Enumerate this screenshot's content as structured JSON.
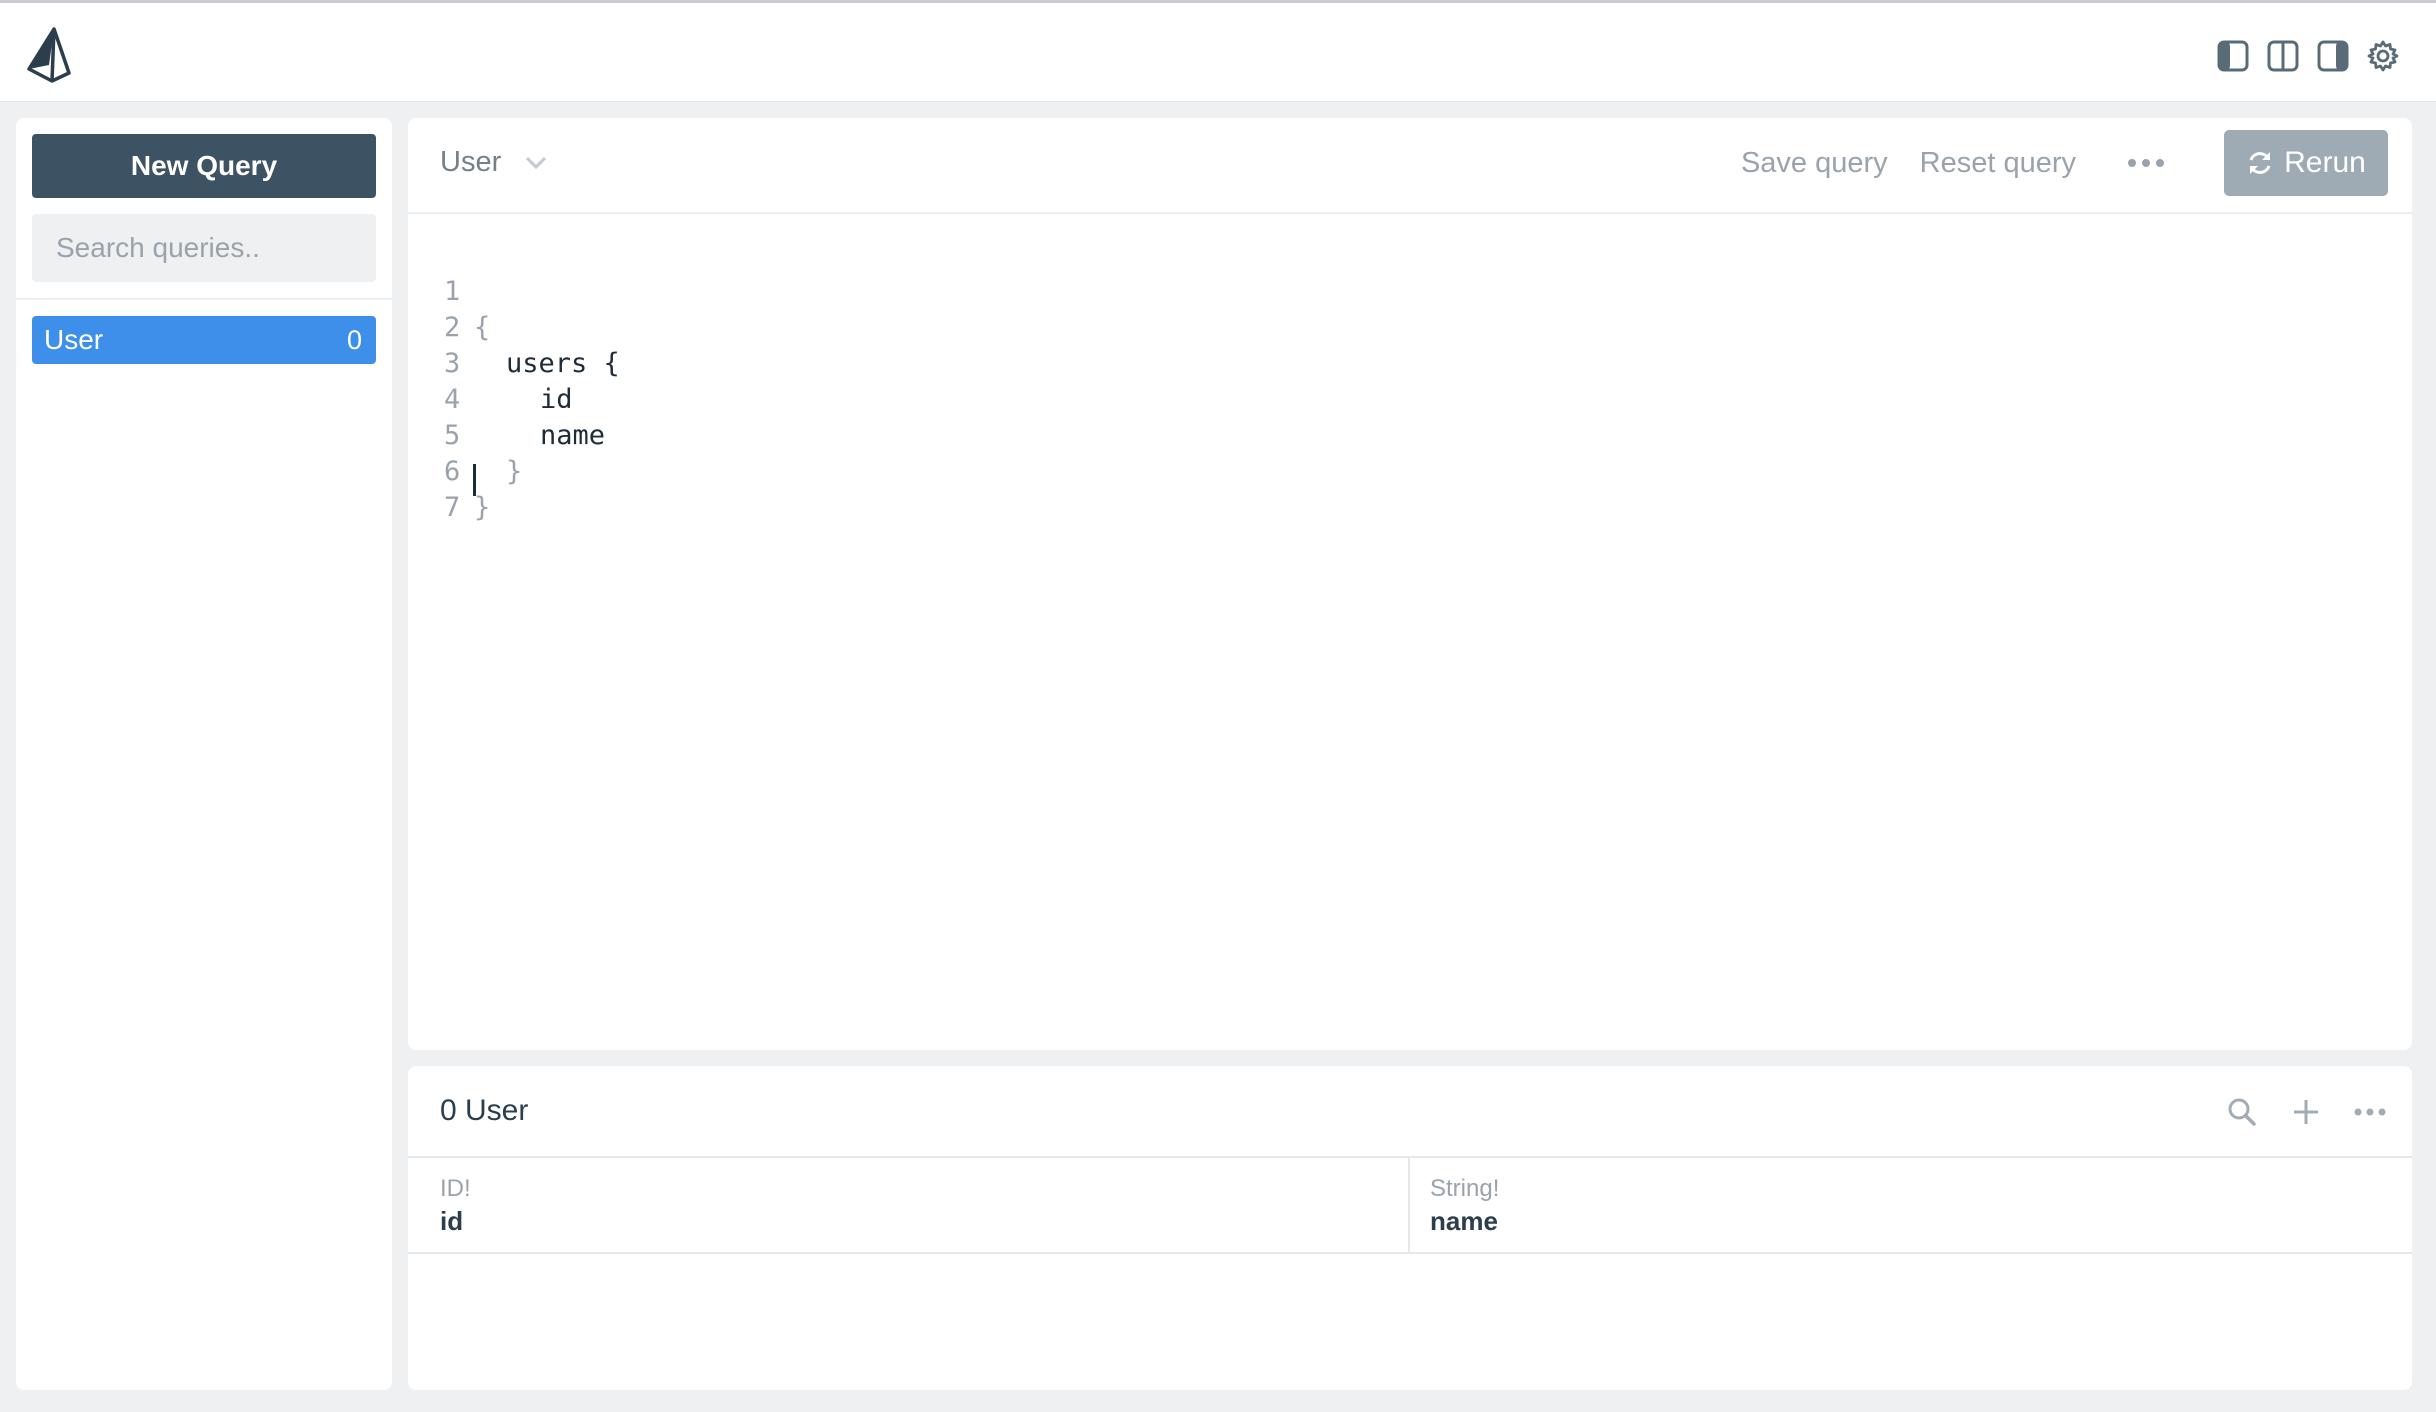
{
  "colors": {
    "primary_button": "#3d5262",
    "selected_item": "#3d8fea",
    "rerun_button": "#9eaab4",
    "muted_text": "#9aa3ab"
  },
  "topbar": {
    "logo_icon": "prisma-logo-icon",
    "layout_icons": [
      "sidebar-left-icon",
      "split-view-icon",
      "sidebar-right-icon",
      "gear-icon"
    ]
  },
  "sidebar": {
    "new_query_label": "New Query",
    "search_placeholder": "Search queries..",
    "search_value": "",
    "items": [
      {
        "label": "User",
        "count": "0"
      }
    ]
  },
  "editor": {
    "query_name": "User",
    "save_label": "Save query",
    "reset_label": "Reset query",
    "rerun_label": "Rerun",
    "lines": [
      {
        "num": "1",
        "code": "{"
      },
      {
        "num": "2",
        "code": "users {"
      },
      {
        "num": "3",
        "code": "id"
      },
      {
        "num": "4",
        "code": "name"
      },
      {
        "num": "5",
        "code": "}"
      },
      {
        "num": "6",
        "code": "}"
      },
      {
        "num": "7",
        "code": ""
      }
    ]
  },
  "results": {
    "title": "0 User",
    "columns": [
      {
        "type": "ID!",
        "name": "id"
      },
      {
        "type": "String!",
        "name": "name"
      }
    ]
  }
}
